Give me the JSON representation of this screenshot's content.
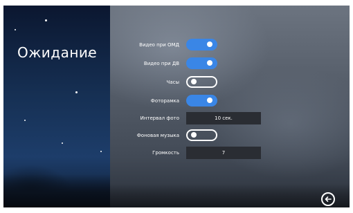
{
  "screen": {
    "title": "Ожидание"
  },
  "settings": [
    {
      "label": "Видео при ОМД",
      "type": "toggle",
      "state": "on"
    },
    {
      "label": "Видео при ДВ",
      "type": "toggle",
      "state": "on"
    },
    {
      "label": "Часы",
      "type": "toggle",
      "state": "off"
    },
    {
      "label": "Фоторамка",
      "type": "toggle",
      "state": "on"
    },
    {
      "label": "Интервал фото",
      "type": "value",
      "value": "10 сек."
    },
    {
      "label": "Фоновая музыка",
      "type": "toggle",
      "state": "off"
    },
    {
      "label": "Громкость",
      "type": "value",
      "value": "7"
    }
  ],
  "colors": {
    "toggle_on": "#3a86e6",
    "field_bg": "#2a2d33"
  },
  "icons": {
    "back": "back-arrow-icon"
  }
}
